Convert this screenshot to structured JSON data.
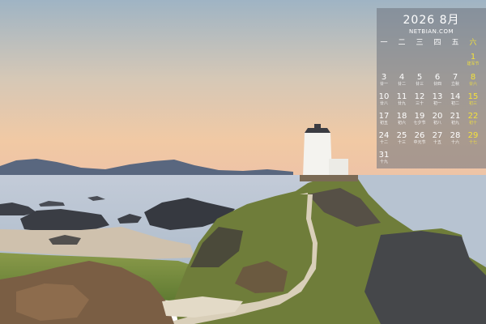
{
  "calendar": {
    "title": "2026 8月",
    "site": "NETBIAN.COM",
    "weekdays": [
      "一",
      "二",
      "三",
      "四",
      "五",
      "六"
    ],
    "days": [
      {
        "n": "1",
        "s": "建军节"
      },
      {
        "n": "3",
        "s": "廿一"
      },
      {
        "n": "4",
        "s": "廿二"
      },
      {
        "n": "5",
        "s": "廿三"
      },
      {
        "n": "6",
        "s": "廿四"
      },
      {
        "n": "7",
        "s": "立秋"
      },
      {
        "n": "8",
        "s": "廿六"
      },
      {
        "n": "10",
        "s": "廿八"
      },
      {
        "n": "11",
        "s": "廿九"
      },
      {
        "n": "12",
        "s": "三十"
      },
      {
        "n": "13",
        "s": "初一"
      },
      {
        "n": "14",
        "s": "初二"
      },
      {
        "n": "15",
        "s": "初三"
      },
      {
        "n": "17",
        "s": "初五"
      },
      {
        "n": "18",
        "s": "初六"
      },
      {
        "n": "19",
        "s": "七夕节"
      },
      {
        "n": "20",
        "s": "初八"
      },
      {
        "n": "21",
        "s": "初九"
      },
      {
        "n": "22",
        "s": "初十"
      },
      {
        "n": "24",
        "s": "十二"
      },
      {
        "n": "25",
        "s": "十三"
      },
      {
        "n": "26",
        "s": "中元节"
      },
      {
        "n": "27",
        "s": "十五"
      },
      {
        "n": "28",
        "s": "十六"
      },
      {
        "n": "29",
        "s": "十七"
      },
      {
        "n": "31",
        "s": "十九"
      }
    ],
    "accent_color": "#f4e23a"
  }
}
